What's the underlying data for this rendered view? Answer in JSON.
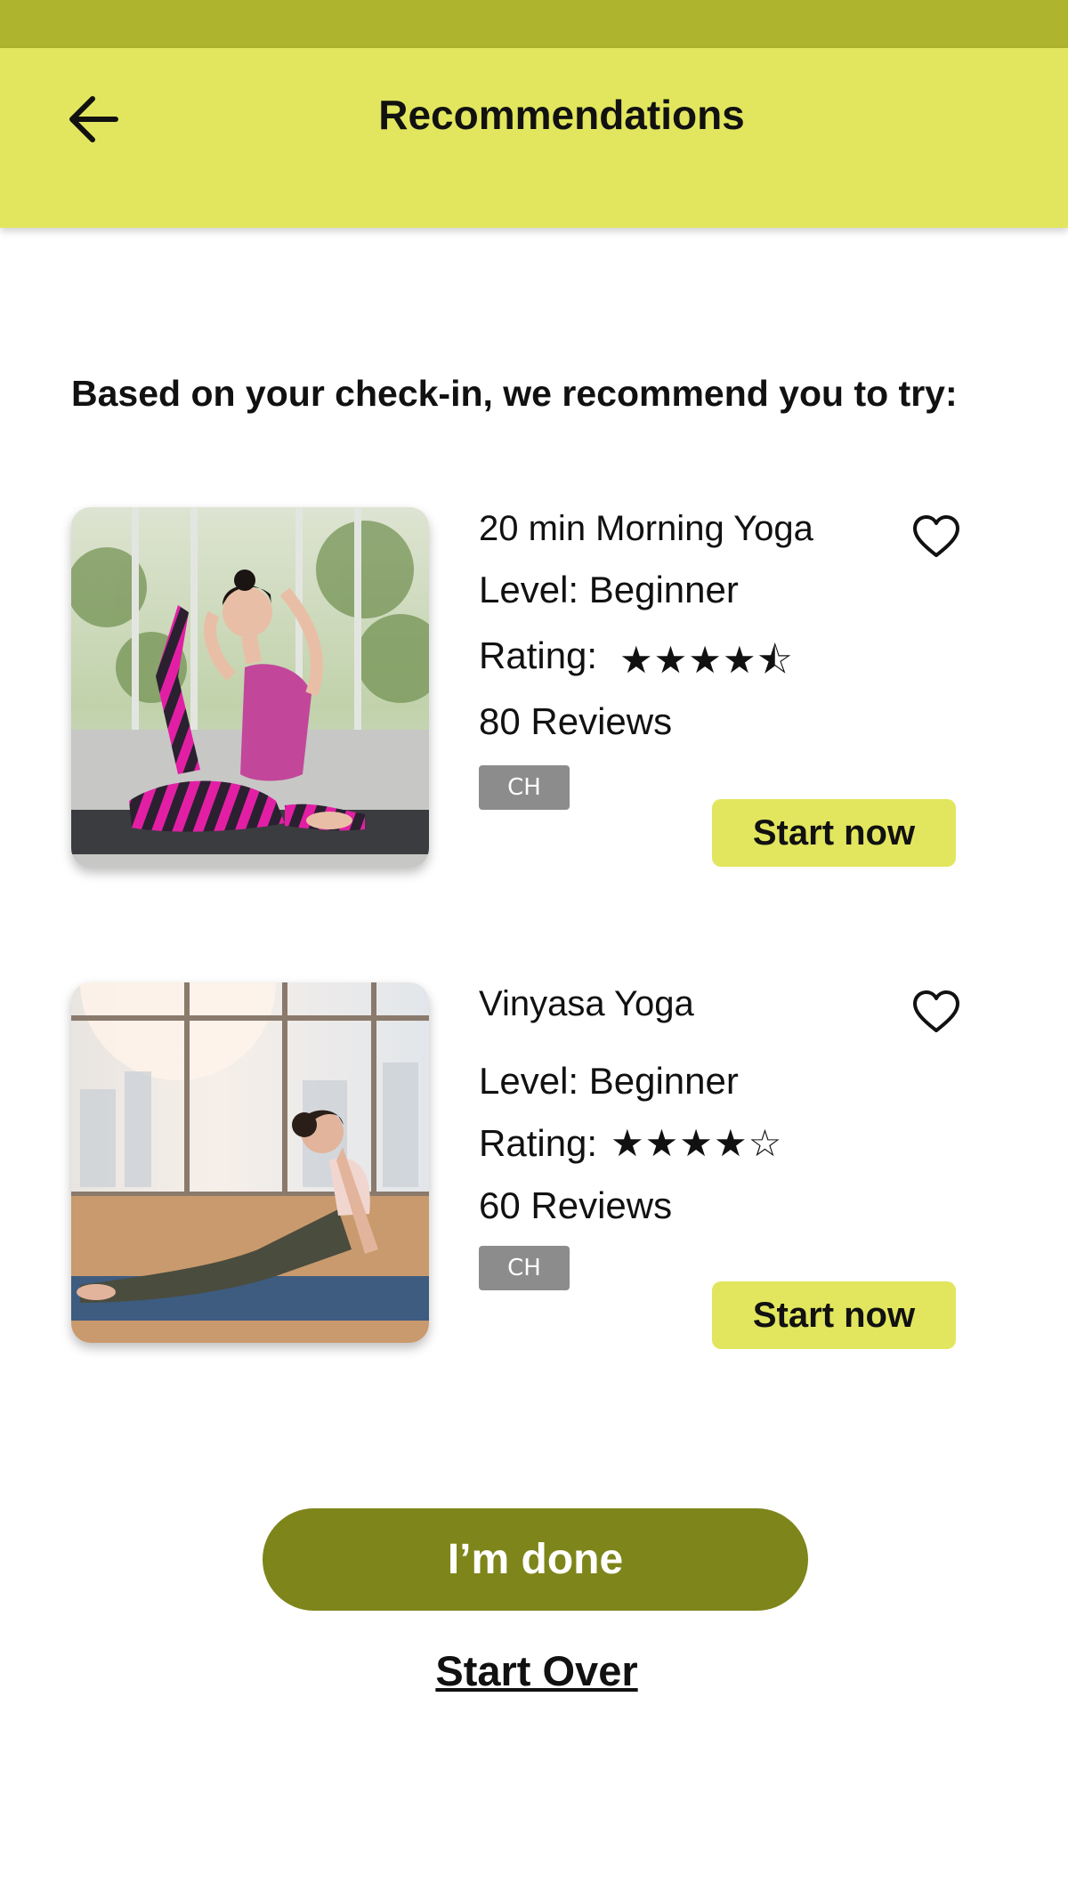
{
  "header": {
    "title": "Recommendations",
    "back_icon": "arrow-left-icon",
    "background": "#e2e65e",
    "status_bar_color": "#aeb42e"
  },
  "intro": "Based on your check-in, we recommend you to try:",
  "recommendations": [
    {
      "title": "20 min Morning Yoga",
      "level": "Level: Beginner",
      "rating_label": "Rating:",
      "rating": 4.5,
      "stars": "★★★★⯪",
      "reviews": "80 Reviews",
      "tag": "CH",
      "cta": "Start now",
      "favorite_icon": "heart-outline-icon"
    },
    {
      "title": "Vinyasa Yoga",
      "level": "Level: Beginner",
      "rating_label": "Rating:",
      "rating": 4,
      "stars": "★★★★☆",
      "reviews": "60 Reviews",
      "tag": "CH",
      "cta": "Start now",
      "favorite_icon": "heart-outline-icon"
    }
  ],
  "actions": {
    "done": "I’m done",
    "start_over": "Start Over",
    "done_color": "#7e851a"
  }
}
